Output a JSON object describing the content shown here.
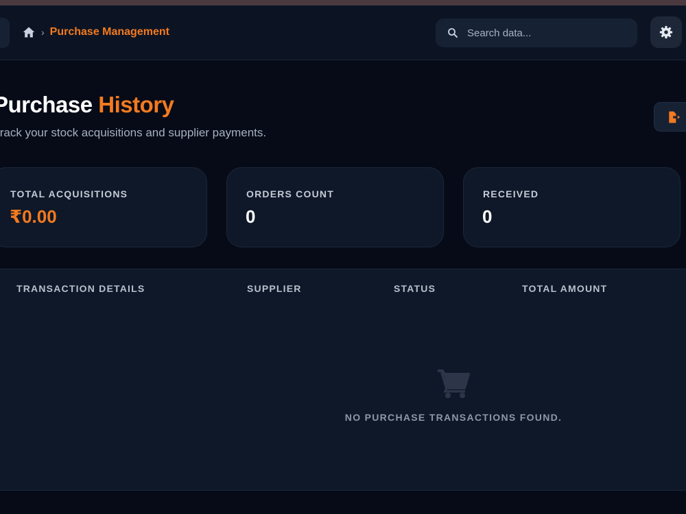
{
  "header": {
    "breadcrumb_current": "Purchase Management",
    "search_placeholder": "Search data..."
  },
  "page": {
    "title_part1": "Purchase",
    "title_part2": "History",
    "subtitle": "Track your stock acquisitions and supplier payments."
  },
  "stats": [
    {
      "label": "TOTAL ACQUISITIONS",
      "value": "₹0.00"
    },
    {
      "label": "ORDERS COUNT",
      "value": "0"
    },
    {
      "label": "RECEIVED",
      "value": "0"
    }
  ],
  "table": {
    "columns": [
      "TRANSACTION DETAILS",
      "SUPPLIER",
      "STATUS",
      "TOTAL AMOUNT"
    ],
    "rows": [],
    "empty_message": "NO PURCHASE TRANSACTIONS FOUND."
  },
  "colors": {
    "accent": "#f47a1f",
    "background": "#060b17",
    "panel": "#0f1828"
  },
  "icons": [
    "home-icon",
    "chevron-right-icon",
    "search-icon",
    "gear-icon",
    "export-icon",
    "cart-icon"
  ]
}
